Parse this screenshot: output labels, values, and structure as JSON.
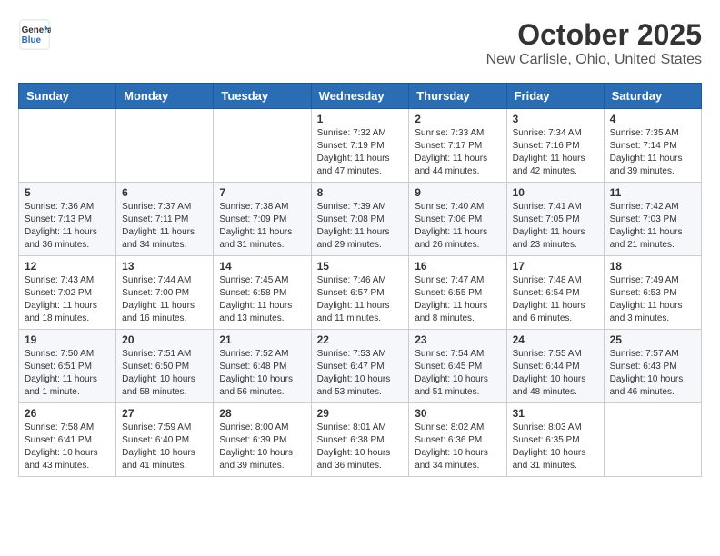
{
  "header": {
    "logo_general": "General",
    "logo_blue": "Blue",
    "title": "October 2025",
    "subtitle": "New Carlisle, Ohio, United States"
  },
  "calendar": {
    "days_of_week": [
      "Sunday",
      "Monday",
      "Tuesday",
      "Wednesday",
      "Thursday",
      "Friday",
      "Saturday"
    ],
    "weeks": [
      [
        {
          "day": "",
          "info": ""
        },
        {
          "day": "",
          "info": ""
        },
        {
          "day": "",
          "info": ""
        },
        {
          "day": "1",
          "info": "Sunrise: 7:32 AM\nSunset: 7:19 PM\nDaylight: 11 hours and 47 minutes."
        },
        {
          "day": "2",
          "info": "Sunrise: 7:33 AM\nSunset: 7:17 PM\nDaylight: 11 hours and 44 minutes."
        },
        {
          "day": "3",
          "info": "Sunrise: 7:34 AM\nSunset: 7:16 PM\nDaylight: 11 hours and 42 minutes."
        },
        {
          "day": "4",
          "info": "Sunrise: 7:35 AM\nSunset: 7:14 PM\nDaylight: 11 hours and 39 minutes."
        }
      ],
      [
        {
          "day": "5",
          "info": "Sunrise: 7:36 AM\nSunset: 7:13 PM\nDaylight: 11 hours and 36 minutes."
        },
        {
          "day": "6",
          "info": "Sunrise: 7:37 AM\nSunset: 7:11 PM\nDaylight: 11 hours and 34 minutes."
        },
        {
          "day": "7",
          "info": "Sunrise: 7:38 AM\nSunset: 7:09 PM\nDaylight: 11 hours and 31 minutes."
        },
        {
          "day": "8",
          "info": "Sunrise: 7:39 AM\nSunset: 7:08 PM\nDaylight: 11 hours and 29 minutes."
        },
        {
          "day": "9",
          "info": "Sunrise: 7:40 AM\nSunset: 7:06 PM\nDaylight: 11 hours and 26 minutes."
        },
        {
          "day": "10",
          "info": "Sunrise: 7:41 AM\nSunset: 7:05 PM\nDaylight: 11 hours and 23 minutes."
        },
        {
          "day": "11",
          "info": "Sunrise: 7:42 AM\nSunset: 7:03 PM\nDaylight: 11 hours and 21 minutes."
        }
      ],
      [
        {
          "day": "12",
          "info": "Sunrise: 7:43 AM\nSunset: 7:02 PM\nDaylight: 11 hours and 18 minutes."
        },
        {
          "day": "13",
          "info": "Sunrise: 7:44 AM\nSunset: 7:00 PM\nDaylight: 11 hours and 16 minutes."
        },
        {
          "day": "14",
          "info": "Sunrise: 7:45 AM\nSunset: 6:58 PM\nDaylight: 11 hours and 13 minutes."
        },
        {
          "day": "15",
          "info": "Sunrise: 7:46 AM\nSunset: 6:57 PM\nDaylight: 11 hours and 11 minutes."
        },
        {
          "day": "16",
          "info": "Sunrise: 7:47 AM\nSunset: 6:55 PM\nDaylight: 11 hours and 8 minutes."
        },
        {
          "day": "17",
          "info": "Sunrise: 7:48 AM\nSunset: 6:54 PM\nDaylight: 11 hours and 6 minutes."
        },
        {
          "day": "18",
          "info": "Sunrise: 7:49 AM\nSunset: 6:53 PM\nDaylight: 11 hours and 3 minutes."
        }
      ],
      [
        {
          "day": "19",
          "info": "Sunrise: 7:50 AM\nSunset: 6:51 PM\nDaylight: 11 hours and 1 minute."
        },
        {
          "day": "20",
          "info": "Sunrise: 7:51 AM\nSunset: 6:50 PM\nDaylight: 10 hours and 58 minutes."
        },
        {
          "day": "21",
          "info": "Sunrise: 7:52 AM\nSunset: 6:48 PM\nDaylight: 10 hours and 56 minutes."
        },
        {
          "day": "22",
          "info": "Sunrise: 7:53 AM\nSunset: 6:47 PM\nDaylight: 10 hours and 53 minutes."
        },
        {
          "day": "23",
          "info": "Sunrise: 7:54 AM\nSunset: 6:45 PM\nDaylight: 10 hours and 51 minutes."
        },
        {
          "day": "24",
          "info": "Sunrise: 7:55 AM\nSunset: 6:44 PM\nDaylight: 10 hours and 48 minutes."
        },
        {
          "day": "25",
          "info": "Sunrise: 7:57 AM\nSunset: 6:43 PM\nDaylight: 10 hours and 46 minutes."
        }
      ],
      [
        {
          "day": "26",
          "info": "Sunrise: 7:58 AM\nSunset: 6:41 PM\nDaylight: 10 hours and 43 minutes."
        },
        {
          "day": "27",
          "info": "Sunrise: 7:59 AM\nSunset: 6:40 PM\nDaylight: 10 hours and 41 minutes."
        },
        {
          "day": "28",
          "info": "Sunrise: 8:00 AM\nSunset: 6:39 PM\nDaylight: 10 hours and 39 minutes."
        },
        {
          "day": "29",
          "info": "Sunrise: 8:01 AM\nSunset: 6:38 PM\nDaylight: 10 hours and 36 minutes."
        },
        {
          "day": "30",
          "info": "Sunrise: 8:02 AM\nSunset: 6:36 PM\nDaylight: 10 hours and 34 minutes."
        },
        {
          "day": "31",
          "info": "Sunrise: 8:03 AM\nSunset: 6:35 PM\nDaylight: 10 hours and 31 minutes."
        },
        {
          "day": "",
          "info": ""
        }
      ]
    ]
  }
}
